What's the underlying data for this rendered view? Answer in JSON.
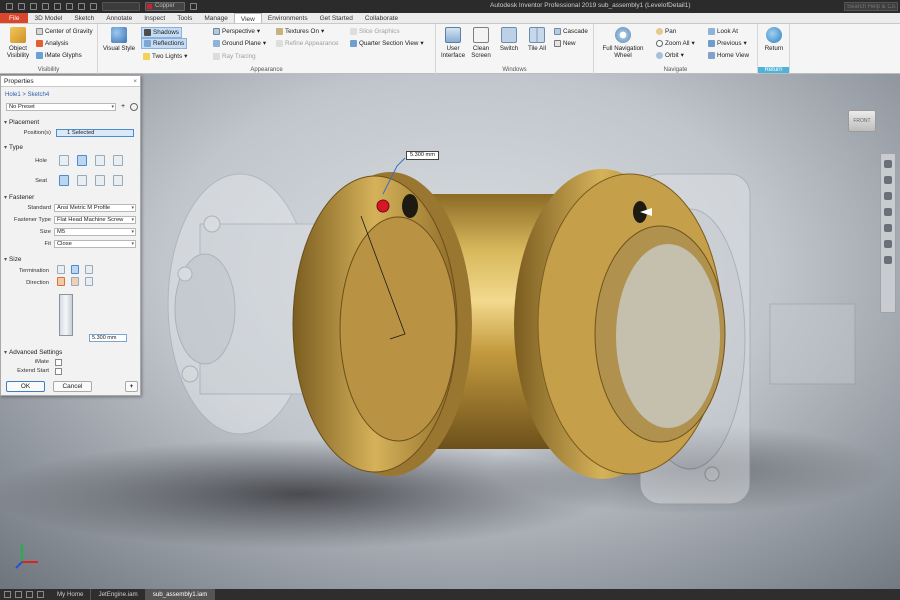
{
  "titlebar": {
    "app_title": "Autodesk Inventor Professional 2019    sub_assembly1 (LevelofDetail1)",
    "material": "Copper",
    "search_placeholder": "Search Help & Co..."
  },
  "menu": {
    "file": "File",
    "tabs": [
      "3D Model",
      "Sketch",
      "Annotate",
      "Inspect",
      "Tools",
      "Manage",
      "View",
      "Environments",
      "Get Started",
      "Collaborate"
    ],
    "active_tab": "View"
  },
  "ribbon": {
    "visibility": {
      "title": "Visibility",
      "object_visibility": "Object Visibility",
      "center_of_gravity": "Center of Gravity",
      "analysis": "Analysis",
      "ilogic_glyphs": "iMate Glyphs"
    },
    "appearance": {
      "title": "Appearance",
      "visual_style": "Visual Style",
      "shadows": "Shadows",
      "reflections": "Reflections",
      "two_lights": "Two Lights",
      "perspective": "Perspective",
      "ground_plane": "Ground Plane",
      "ray_tracing": "Ray Tracing",
      "textures_on": "Textures On",
      "refine_appearance": "Refine Appearance",
      "slice_graphics": "Slice Graphics",
      "quarter_section_view": "Quarter Section View"
    },
    "windows": {
      "title": "Windows",
      "user_interface": "User Interface",
      "clean_screen": "Clean Screen",
      "switch": "Switch",
      "tile_all": "Tile All",
      "cascade": "Cascade",
      "new": "New"
    },
    "navigate": {
      "title": "Navigate",
      "full_navigation_wheel": "Full Navigation Wheel",
      "pan": "Pan",
      "zoom_all": "Zoom All",
      "orbit": "Orbit",
      "look_at": "Look At",
      "previous": "Previous",
      "home_view": "Home View"
    },
    "return": {
      "title": "Return",
      "return": "Return"
    }
  },
  "properties": {
    "title": "Properties",
    "close": "×",
    "breadcrumb": "Hole1 > Sketch4",
    "preset": "No Preset",
    "sections": {
      "placement": "Placement",
      "type": "Type",
      "fastener": "Fastener",
      "size": "Size",
      "advanced": "Advanced Settings"
    },
    "labels": {
      "positions": "Position(s)",
      "hole": "Hole",
      "seat": "Seat",
      "standard": "Standard",
      "fastener_type": "Fastener Type",
      "size": "Size",
      "fit": "Fit",
      "termination": "Termination",
      "direction": "Direction",
      "iMate": "iMate",
      "extend_start": "Extend Start"
    },
    "values": {
      "positions": "1 Selected",
      "standard": "Ansi Metric M Profile",
      "fastener_type": "Flat Head Machine Screw",
      "size": "M5",
      "fit": "Close",
      "depth": "5.300 mm"
    },
    "buttons": {
      "ok": "OK",
      "cancel": "Cancel",
      "add": "+"
    }
  },
  "viewport": {
    "viewcube_label": "FRONT",
    "measure_value": "5.300 mm"
  },
  "statusbar": {
    "tabs": [
      "My Home",
      "JetEngine.iam",
      "sub_assembly1.iam"
    ],
    "active_tab": "sub_assembly1.iam"
  },
  "colors": {
    "accent": "#d9462c",
    "selection": "#4b8dd0",
    "brass": "#c29a3f"
  }
}
